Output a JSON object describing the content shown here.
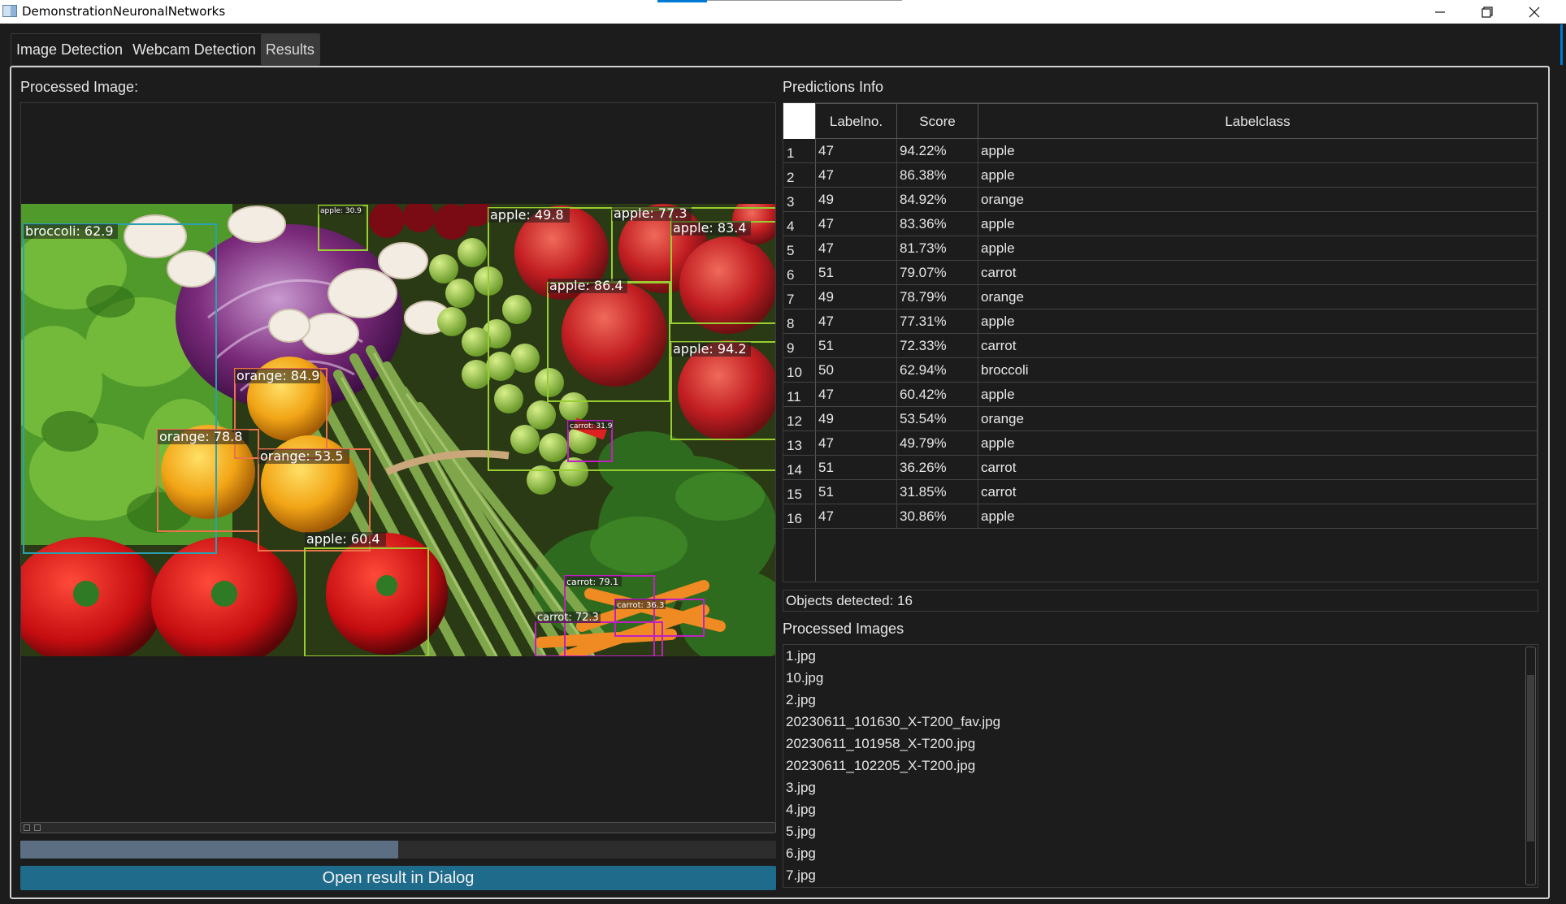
{
  "window": {
    "title": "DemonstrationNeuronalNetworks"
  },
  "tabs": [
    {
      "label": "Image Detection"
    },
    {
      "label": "Webcam Detection"
    },
    {
      "label": "Results"
    }
  ],
  "left": {
    "processed_image_label": "Processed Image:",
    "progress_fraction": 0.5,
    "open_button_label": "Open result in Dialog"
  },
  "detections": [
    {
      "text": "broccoli: 62.9",
      "cls": "broccoli"
    },
    {
      "text": "apple: 30.9",
      "cls": "apple"
    },
    {
      "text": "apple: 49.8",
      "cls": "apple"
    },
    {
      "text": "apple: 77.3",
      "cls": "apple"
    },
    {
      "text": "apple: 83.4",
      "cls": "apple"
    },
    {
      "text": "apple: 86.4",
      "cls": "apple"
    },
    {
      "text": "apple: 94.2",
      "cls": "apple"
    },
    {
      "text": "orange: 84.9",
      "cls": "orange"
    },
    {
      "text": "orange: 78.8",
      "cls": "orange"
    },
    {
      "text": "orange: 53.5",
      "cls": "orange"
    },
    {
      "text": "carrot: 31.9",
      "cls": "carrot"
    },
    {
      "text": "apple: 60.4",
      "cls": "apple"
    },
    {
      "text": "carrot: 79.1",
      "cls": "carrot"
    },
    {
      "text": "carrot: 36.3",
      "cls": "carrot"
    },
    {
      "text": "carrot: 72.3",
      "cls": "carrot"
    }
  ],
  "predictions": {
    "title": "Predictions Info",
    "columns": [
      "Labelno.",
      "Score",
      "Labelclass"
    ],
    "rows": [
      {
        "idx": "1",
        "label": "47",
        "score": "94.22%",
        "cls": "apple"
      },
      {
        "idx": "2",
        "label": "47",
        "score": "86.38%",
        "cls": "apple"
      },
      {
        "idx": "3",
        "label": "49",
        "score": "84.92%",
        "cls": "orange"
      },
      {
        "idx": "4",
        "label": "47",
        "score": "83.36%",
        "cls": "apple"
      },
      {
        "idx": "5",
        "label": "47",
        "score": "81.73%",
        "cls": "apple"
      },
      {
        "idx": "6",
        "label": "51",
        "score": "79.07%",
        "cls": "carrot"
      },
      {
        "idx": "7",
        "label": "49",
        "score": "78.79%",
        "cls": "orange"
      },
      {
        "idx": "8",
        "label": "47",
        "score": "77.31%",
        "cls": "apple"
      },
      {
        "idx": "9",
        "label": "51",
        "score": "72.33%",
        "cls": "carrot"
      },
      {
        "idx": "10",
        "label": "50",
        "score": "62.94%",
        "cls": "broccoli"
      },
      {
        "idx": "11",
        "label": "47",
        "score": "60.42%",
        "cls": "apple"
      },
      {
        "idx": "12",
        "label": "49",
        "score": "53.54%",
        "cls": "orange"
      },
      {
        "idx": "13",
        "label": "47",
        "score": "49.79%",
        "cls": "apple"
      },
      {
        "idx": "14",
        "label": "51",
        "score": "36.26%",
        "cls": "carrot"
      },
      {
        "idx": "15",
        "label": "51",
        "score": "31.85%",
        "cls": "carrot"
      },
      {
        "idx": "16",
        "label": "47",
        "score": "30.86%",
        "cls": "apple"
      }
    ],
    "objects_detected": "Objects detected: 16"
  },
  "processed_images": {
    "title": "Processed Images",
    "files": [
      "1.jpg",
      "10.jpg",
      "2.jpg",
      "20230611_101630_X-T200_fav.jpg",
      "20230611_101958_X-T200.jpg",
      "20230611_102205_X-T200.jpg",
      "3.jpg",
      "4.jpg",
      "5.jpg",
      "6.jpg",
      "7.jpg"
    ]
  },
  "colors": {
    "accent": "#0078d4",
    "button": "#1f6b8b",
    "apple": "#9acd32",
    "orange": "#e9744a",
    "carrot": "#c020c0",
    "broccoli": "#2aa0b0"
  }
}
